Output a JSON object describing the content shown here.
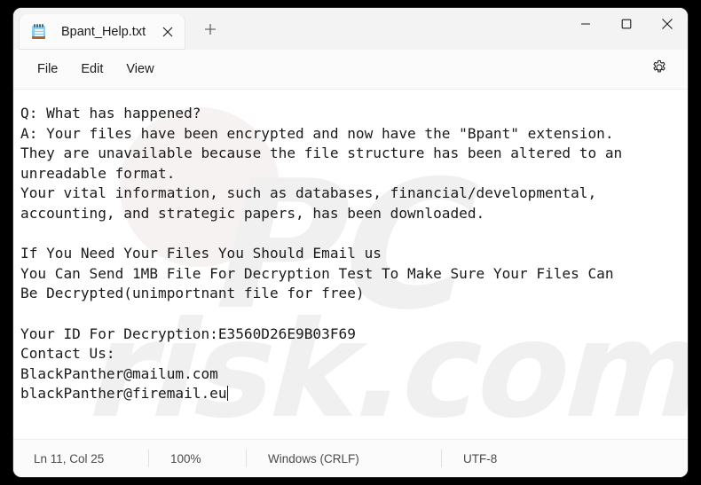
{
  "window": {
    "tab": {
      "title": "Bpant_Help.txt",
      "icon": "notepad-icon",
      "close_icon": "close-icon"
    },
    "new_tab_icon": "plus-icon",
    "caption": {
      "minimize_icon": "minimize-icon",
      "maximize_icon": "maximize-icon",
      "close_icon": "close-icon"
    }
  },
  "menubar": {
    "items": [
      {
        "label": "File"
      },
      {
        "label": "Edit"
      },
      {
        "label": "View"
      }
    ],
    "settings_icon": "gear-icon"
  },
  "editor": {
    "text": "Q: What has happened?\nA: Your files have been encrypted and now have the \"Bpant\" extension.\nThey are unavailable because the file structure has been altered to an\nunreadable format.\nYour vital information, such as databases, financial/developmental,\naccounting, and strategic papers, has been downloaded.\n\nIf You Need Your Files You Should Email us\nYou Can Send 1MB File For Decryption Test To Make Sure Your Files Can\nBe Decrypted(unimportnant file for free)\n\nYour ID For Decryption:E3560D26E9B03F69\nContact Us:\nBlackPanther@mailum.com\nblackPanther@firemail.eu",
    "watermark_1": "PC",
    "watermark_2": "risk.com"
  },
  "statusbar": {
    "position": "Ln 11, Col 25",
    "zoom": "100%",
    "line_endings": "Windows (CRLF)",
    "encoding": "UTF-8"
  },
  "colors": {
    "window_chrome": "#f3f3f3",
    "tab_active": "#fbfbfb",
    "editor_bg": "#ffffff",
    "text": "#1a1a1a",
    "desktop": "#000000",
    "icon_blue": "#7cc2e0",
    "icon_brown": "#b0652e"
  }
}
